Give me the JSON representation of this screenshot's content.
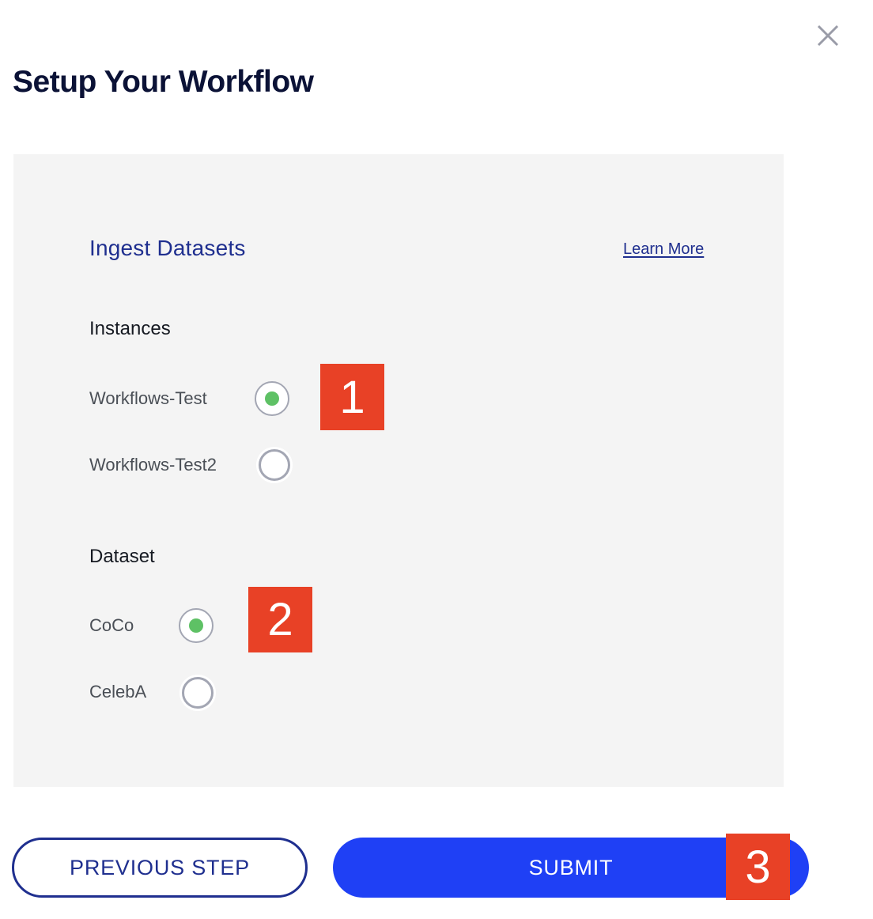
{
  "header": {
    "title": "Setup Your Workflow",
    "close_icon": "close-icon"
  },
  "panel": {
    "title": "Ingest Datasets",
    "learn_more": "Learn More",
    "instances": {
      "label": "Instances",
      "options": [
        {
          "label": "Workflows-Test",
          "selected": true
        },
        {
          "label": "Workflows-Test2",
          "selected": false
        }
      ]
    },
    "dataset": {
      "label": "Dataset",
      "options": [
        {
          "label": "CoCo",
          "selected": true
        },
        {
          "label": "CelebA",
          "selected": false
        }
      ]
    }
  },
  "annotations": [
    "1",
    "2",
    "3"
  ],
  "footer": {
    "previous_label": "PREVIOUS STEP",
    "submit_label": "SUBMIT"
  },
  "colors": {
    "title": "#0b1236",
    "accent_dark_blue": "#1f2f8f",
    "primary_blue": "#1f40f5",
    "radio_selected": "#5ec165",
    "annotation_red": "#e84126",
    "panel_bg": "#f4f4f4"
  }
}
